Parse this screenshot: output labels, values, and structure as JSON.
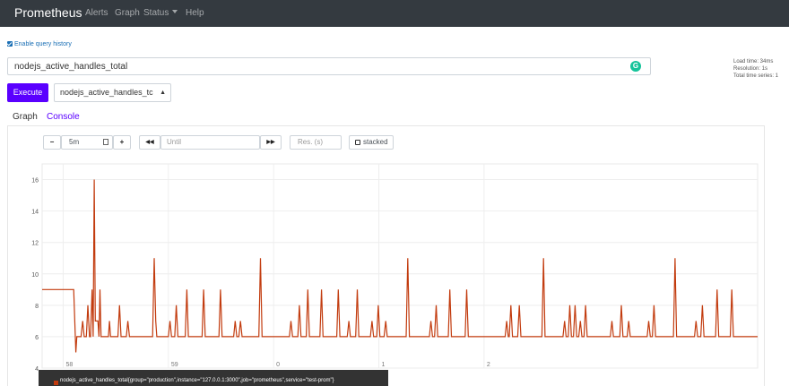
{
  "nav": {
    "brand": "Prometheus",
    "items": [
      "Alerts",
      "Graph",
      "Status",
      "Help"
    ]
  },
  "history_label": "Enable query history",
  "stats": [
    "Load time: 34ms",
    "Resolution: 1s",
    "Total time series: 1"
  ],
  "expression": "nodejs_active_handles_total",
  "grammarly_letter": "G",
  "execute_label": "Execute",
  "metric_select": "nodejs_active_handles_tc",
  "tabs": [
    "Graph",
    "Console"
  ],
  "controls": {
    "minus": "−",
    "range": "5m",
    "plus": "+",
    "back": "◀◀",
    "until_placeholder": "Until",
    "forward": "▶▶",
    "res_placeholder": "Res. (s)",
    "stacked": "stacked"
  },
  "legend_text": "nodejs_active_handles_total{group=\"production\",instance=\"127.0.0.1:3000\",job=\"prometheus\",service=\"test-prom\"}",
  "colors": {
    "series": "#c23b0e",
    "accent": "#5a00ff",
    "nav": "#343a40"
  },
  "chart_data": {
    "type": "line",
    "ylim": [
      4,
      17
    ],
    "y_ticks": [
      4,
      6,
      8,
      10,
      12,
      14,
      16
    ],
    "x_ticks": [
      "58",
      "59",
      "0",
      "1",
      "2"
    ],
    "grid": true,
    "legend": "bottom-left",
    "series": [
      {
        "name": "nodejs_active_handles_total{group=\"production\",instance=\"127.0.0.1:3000\",job=\"prometheus\",service=\"test-prom\"}",
        "points": [
          [
            -0.2,
            9
          ],
          [
            0.1,
            9
          ],
          [
            0.12,
            5
          ],
          [
            0.13,
            6
          ],
          [
            0.17,
            6
          ],
          [
            0.185,
            7
          ],
          [
            0.2,
            6
          ],
          [
            0.22,
            6
          ],
          [
            0.235,
            8
          ],
          [
            0.25,
            6
          ],
          [
            0.26,
            6
          ],
          [
            0.275,
            9
          ],
          [
            0.285,
            6
          ],
          [
            0.295,
            16
          ],
          [
            0.305,
            7
          ],
          [
            0.33,
            7
          ],
          [
            0.34,
            6
          ],
          [
            0.35,
            9
          ],
          [
            0.36,
            6
          ],
          [
            0.43,
            6
          ],
          [
            0.44,
            7
          ],
          [
            0.45,
            6
          ],
          [
            0.52,
            6
          ],
          [
            0.535,
            8
          ],
          [
            0.55,
            6
          ],
          [
            0.6,
            6
          ],
          [
            0.615,
            7
          ],
          [
            0.63,
            6
          ],
          [
            0.85,
            6
          ],
          [
            0.865,
            11
          ],
          [
            0.88,
            7
          ],
          [
            0.89,
            6
          ],
          [
            1.0,
            6
          ],
          [
            1.015,
            7
          ],
          [
            1.03,
            6
          ],
          [
            1.06,
            6
          ],
          [
            1.075,
            8
          ],
          [
            1.09,
            6
          ],
          [
            1.16,
            6
          ],
          [
            1.175,
            9
          ],
          [
            1.19,
            6
          ],
          [
            1.32,
            6
          ],
          [
            1.335,
            9
          ],
          [
            1.35,
            6
          ],
          [
            1.48,
            6
          ],
          [
            1.495,
            9
          ],
          [
            1.51,
            6
          ],
          [
            1.62,
            6
          ],
          [
            1.635,
            7
          ],
          [
            1.65,
            6
          ],
          [
            1.67,
            6
          ],
          [
            1.685,
            7
          ],
          [
            1.7,
            6
          ],
          [
            1.86,
            6
          ],
          [
            1.875,
            11
          ],
          [
            1.89,
            6
          ],
          [
            2.15,
            6
          ],
          [
            2.165,
            7
          ],
          [
            2.18,
            6
          ],
          [
            2.23,
            6
          ],
          [
            2.245,
            8
          ],
          [
            2.26,
            6
          ],
          [
            2.31,
            6
          ],
          [
            2.325,
            9
          ],
          [
            2.34,
            6
          ],
          [
            2.44,
            6
          ],
          [
            2.455,
            9
          ],
          [
            2.47,
            6
          ],
          [
            2.6,
            6
          ],
          [
            2.615,
            9
          ],
          [
            2.63,
            6
          ],
          [
            2.7,
            6
          ],
          [
            2.715,
            7
          ],
          [
            2.73,
            6
          ],
          [
            2.78,
            6
          ],
          [
            2.795,
            9
          ],
          [
            2.81,
            6
          ],
          [
            2.92,
            6
          ],
          [
            2.935,
            7
          ],
          [
            2.95,
            6
          ],
          [
            2.98,
            6
          ],
          [
            2.995,
            8
          ],
          [
            3.01,
            6
          ],
          [
            3.05,
            6
          ],
          [
            3.065,
            7
          ],
          [
            3.08,
            6
          ],
          [
            3.26,
            6
          ],
          [
            3.275,
            11
          ],
          [
            3.29,
            6
          ],
          [
            3.48,
            6
          ],
          [
            3.495,
            7
          ],
          [
            3.51,
            6
          ],
          [
            3.53,
            6
          ],
          [
            3.545,
            8
          ],
          [
            3.56,
            6
          ],
          [
            3.66,
            6
          ],
          [
            3.675,
            9
          ],
          [
            3.69,
            6
          ],
          [
            3.82,
            6
          ],
          [
            3.835,
            9
          ],
          [
            3.85,
            6
          ],
          [
            4.2,
            6
          ],
          [
            4.215,
            7
          ],
          [
            4.23,
            6
          ],
          [
            4.24,
            6
          ],
          [
            4.255,
            8
          ],
          [
            4.27,
            6
          ],
          [
            4.32,
            6
          ],
          [
            4.335,
            8
          ],
          [
            4.35,
            6
          ],
          [
            4.55,
            6
          ],
          [
            4.565,
            11
          ],
          [
            4.58,
            6
          ],
          [
            4.75,
            6
          ],
          [
            4.765,
            7
          ],
          [
            4.78,
            6
          ],
          [
            4.8,
            6
          ],
          [
            4.815,
            8
          ],
          [
            4.83,
            6
          ],
          [
            4.85,
            6
          ],
          [
            4.865,
            8
          ],
          [
            4.88,
            6
          ],
          [
            4.9,
            6
          ],
          [
            4.915,
            7
          ],
          [
            4.93,
            6
          ],
          [
            4.95,
            6
          ],
          [
            4.965,
            8
          ],
          [
            4.98,
            6
          ],
          [
            5.2,
            6
          ],
          [
            5.215,
            7
          ],
          [
            5.23,
            6
          ],
          [
            5.29,
            6
          ],
          [
            5.305,
            8
          ],
          [
            5.32,
            6
          ],
          [
            5.36,
            6
          ],
          [
            5.375,
            7
          ],
          [
            5.39,
            6
          ],
          [
            5.55,
            6
          ],
          [
            5.565,
            7
          ],
          [
            5.58,
            6
          ],
          [
            5.6,
            6
          ],
          [
            5.615,
            8
          ],
          [
            5.63,
            6
          ],
          [
            5.8,
            6
          ],
          [
            5.815,
            11
          ],
          [
            5.83,
            6
          ],
          [
            6.0,
            6
          ],
          [
            6.015,
            7
          ],
          [
            6.03,
            6
          ],
          [
            6.06,
            6
          ],
          [
            6.075,
            8
          ],
          [
            6.09,
            6
          ],
          [
            6.2,
            6
          ],
          [
            6.215,
            9
          ],
          [
            6.23,
            6
          ],
          [
            6.34,
            6
          ],
          [
            6.355,
            9
          ],
          [
            6.37,
            6
          ],
          [
            6.6,
            6
          ]
        ]
      }
    ]
  }
}
